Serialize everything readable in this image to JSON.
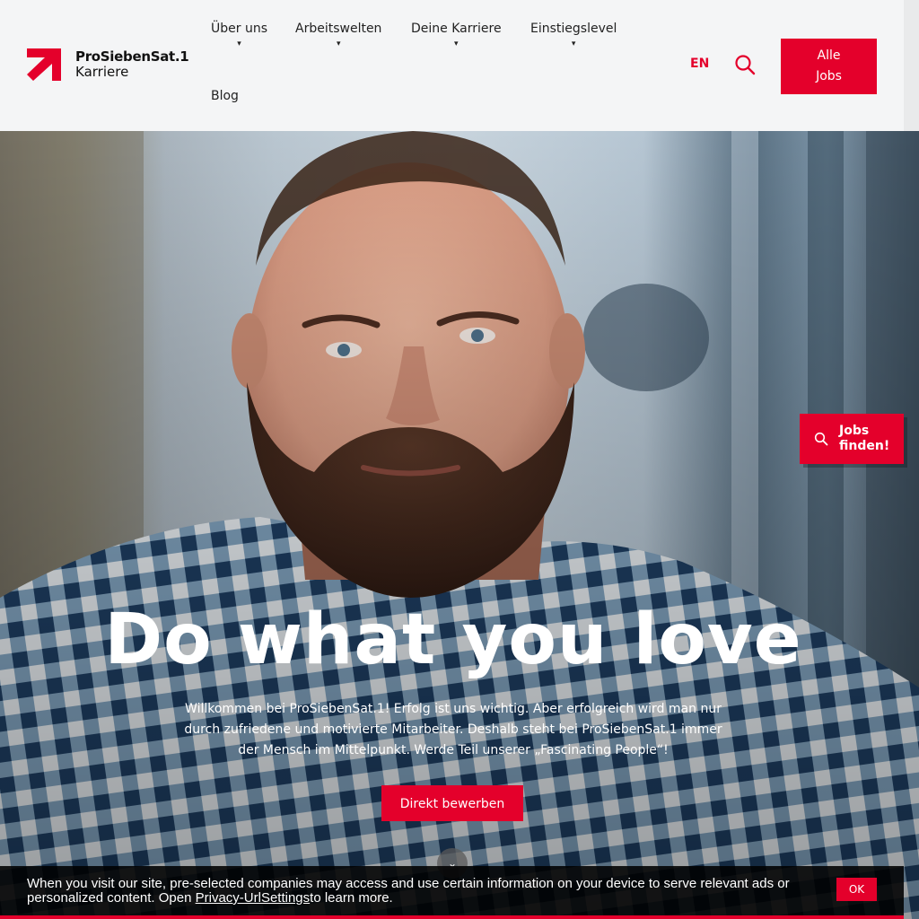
{
  "header": {
    "logo_brand": "ProSiebenSat.1",
    "logo_sub": "Karriere",
    "nav": [
      {
        "label": "Über uns",
        "has_dropdown": true
      },
      {
        "label": "Arbeitswelten",
        "has_dropdown": true
      },
      {
        "label": "Deine Karriere",
        "has_dropdown": true
      },
      {
        "label": "Einstiegslevel",
        "has_dropdown": true
      },
      {
        "label": "Blog",
        "has_dropdown": false
      }
    ],
    "caret": "▾",
    "lang": "EN",
    "search_icon": "search-icon",
    "all_jobs_line1": "Alle",
    "all_jobs_line2": "Jobs"
  },
  "hero": {
    "title": "Do what you love",
    "text": "Willkommen bei ProSiebenSat.1! Erfolg ist uns wichtig. Aber erfolgreich wird man nur durch zufriedene und motivierte Mitarbeiter. Deshalb steht bei ProSiebenSat.1 immer der Mensch im Mittelpunkt. Werde Teil unserer „Fascinating People“!",
    "apply_label": "Direkt bewerben",
    "scroll_icon": "chevron-down-icon",
    "scroll_glyph": "⌄"
  },
  "floating": {
    "jobs_finden_line1": "Jobs",
    "jobs_finden_line2": "finden!"
  },
  "cookie": {
    "text_before": "When you visit our site, pre-selected companies may access and use certain information on your device to serve relevant ads or personalized content. Open ",
    "link": "Privacy-UrlSettings",
    "text_after": "to learn more.",
    "ok_label": "OK"
  },
  "colors": {
    "brand_red": "#e4002b",
    "header_bg": "#f4f5f6"
  }
}
